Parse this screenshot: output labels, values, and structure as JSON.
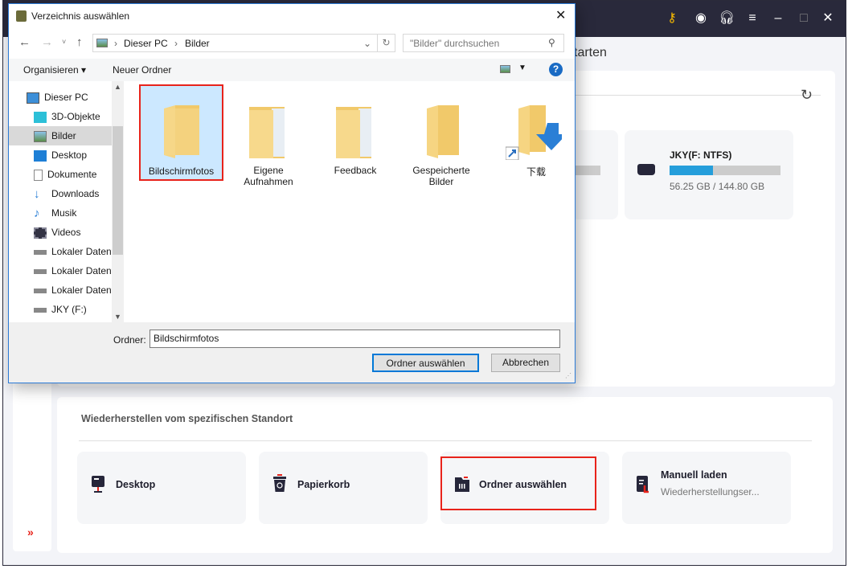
{
  "app": {
    "title_fragment": "tarten",
    "toolbar_icons": [
      "key-icon",
      "disc-icon",
      "headset-icon",
      "menu-icon",
      "minimize-icon",
      "maximize-icon",
      "close-icon"
    ],
    "disk": {
      "name": "JKY(F: NTFS)",
      "usage": "56.25 GB / 144.80 GB",
      "used_fraction": 0.388
    },
    "section_title": "Wiederherstellen vom spezifischen Standort",
    "locations": [
      {
        "label": "Desktop"
      },
      {
        "label": "Papierkorb"
      },
      {
        "label": "Ordner auswählen"
      },
      {
        "label": "Manuell laden",
        "sub": "Wiederherstellungser..."
      }
    ],
    "expand_icon": "»",
    "accent": "#259edb",
    "highlight": "#e8231b"
  },
  "dialog": {
    "title": "Verzeichnis auswählen",
    "breadcrumb": [
      "Dieser PC",
      "Bilder"
    ],
    "search_placeholder": "\"Bilder\" durchsuchen",
    "organize": "Organisieren",
    "new_folder": "Neuer Ordner",
    "nav": [
      "Dieser PC",
      "3D-Objekte",
      "Bilder",
      "Desktop",
      "Dokumente",
      "Downloads",
      "Musik",
      "Videos",
      "Lokaler Datenträger",
      "Lokaler Datenträger",
      "Lokaler Datenträger",
      "JKY (F:)"
    ],
    "folders": [
      {
        "name": "Bildschirmfotos"
      },
      {
        "name": "Eigene Aufnahmen"
      },
      {
        "name": "Feedback"
      },
      {
        "name": "Gespeicherte Bilder"
      },
      {
        "name": "下载"
      }
    ],
    "folder_label": "Ordner:",
    "folder_value": "Bildschirmfotos",
    "select_button": "Ordner auswählen",
    "cancel_button": "Abbrechen"
  }
}
